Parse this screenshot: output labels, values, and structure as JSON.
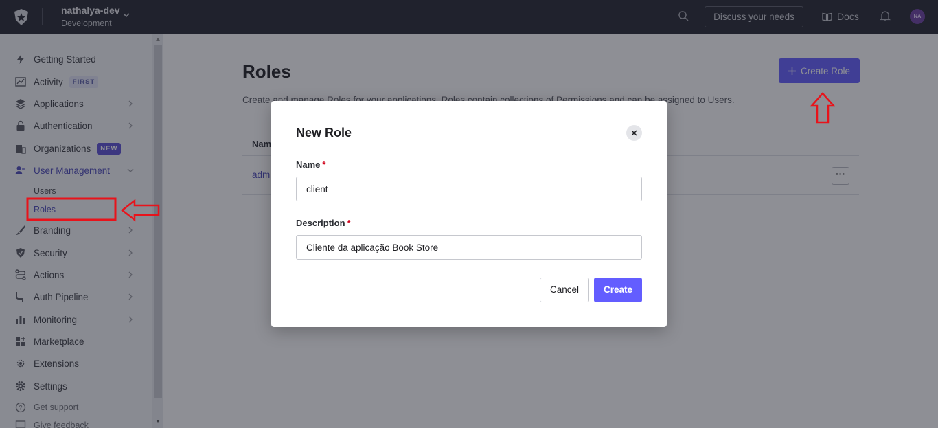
{
  "topbar": {
    "tenant_name": "nathalya-dev",
    "tenant_env": "Development",
    "discuss_label": "Discuss your needs",
    "docs_label": "Docs",
    "avatar_initials": "NA"
  },
  "sidebar": {
    "items": [
      {
        "label": "Getting Started",
        "icon": "bolt-icon"
      },
      {
        "label": "Activity",
        "icon": "activity-chart-icon",
        "badge": "FIRST"
      },
      {
        "label": "Applications",
        "icon": "layers-icon"
      },
      {
        "label": "Authentication",
        "icon": "lock-icon"
      },
      {
        "label": "Organizations",
        "icon": "building-icon",
        "badge": "NEW"
      },
      {
        "label": "User Management",
        "icon": "users-icon"
      },
      {
        "label": "Branding",
        "icon": "brush-icon"
      },
      {
        "label": "Security",
        "icon": "shield-icon"
      },
      {
        "label": "Actions",
        "icon": "flow-icon"
      },
      {
        "label": "Auth Pipeline",
        "icon": "pipeline-icon"
      },
      {
        "label": "Monitoring",
        "icon": "bar-chart-icon"
      },
      {
        "label": "Marketplace",
        "icon": "grid-plus-icon"
      },
      {
        "label": "Extensions",
        "icon": "gear-outline-icon"
      },
      {
        "label": "Settings",
        "icon": "gear-icon"
      },
      {
        "label": "Get support",
        "icon": "help-circle-icon"
      },
      {
        "label": "Give feedback",
        "icon": "feedback-icon"
      }
    ],
    "sub_items": [
      {
        "label": "Users"
      },
      {
        "label": "Roles"
      }
    ]
  },
  "main": {
    "title": "Roles",
    "description": "Create and manage Roles for your applications. Roles contain collections of Permissions and can be assigned to Users.",
    "create_label": "Create Role",
    "table_header": "Name",
    "row_name": "admin",
    "row_menu": "···"
  },
  "modal": {
    "title": "New Role",
    "name_label": "Name",
    "name_value": "client",
    "description_label": "Description",
    "description_value": "Cliente da aplicação Book Store",
    "required_mark": "*",
    "cancel_label": "Cancel",
    "create_label": "Create"
  },
  "colors": {
    "topbar": "#23252f",
    "accent": "#635dff",
    "active_nav": "#4b49b8",
    "annotation": "#e8131b"
  }
}
